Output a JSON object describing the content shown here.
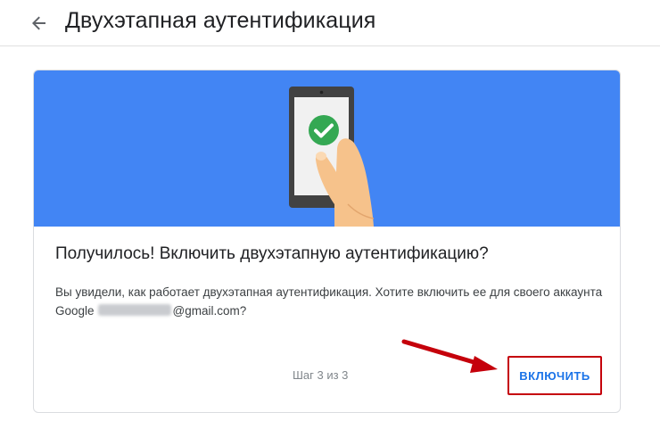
{
  "header": {
    "back_icon": "arrow-left-icon",
    "title": "Двухэтапная аутентификация"
  },
  "card": {
    "illustration_icon": "phone-checkmark-hand-illustration",
    "colors": {
      "banner": "#4285f4",
      "check": "#34a853",
      "highlight_border": "#c5000b",
      "button_text": "#1a73e8"
    },
    "title": "Получилось! Включить двухэтапную аутентификацию?",
    "body_text_1": "Вы увидели, как работает двухэтапная аутентификация. Хотите включить ее для своего аккаунта Google",
    "email_domain": "@gmail.com?",
    "step_label": "Шаг 3 из 3",
    "enable_button": "ВКЛЮЧИТЬ"
  },
  "annotation": {
    "arrow_icon": "red-arrow-icon"
  }
}
